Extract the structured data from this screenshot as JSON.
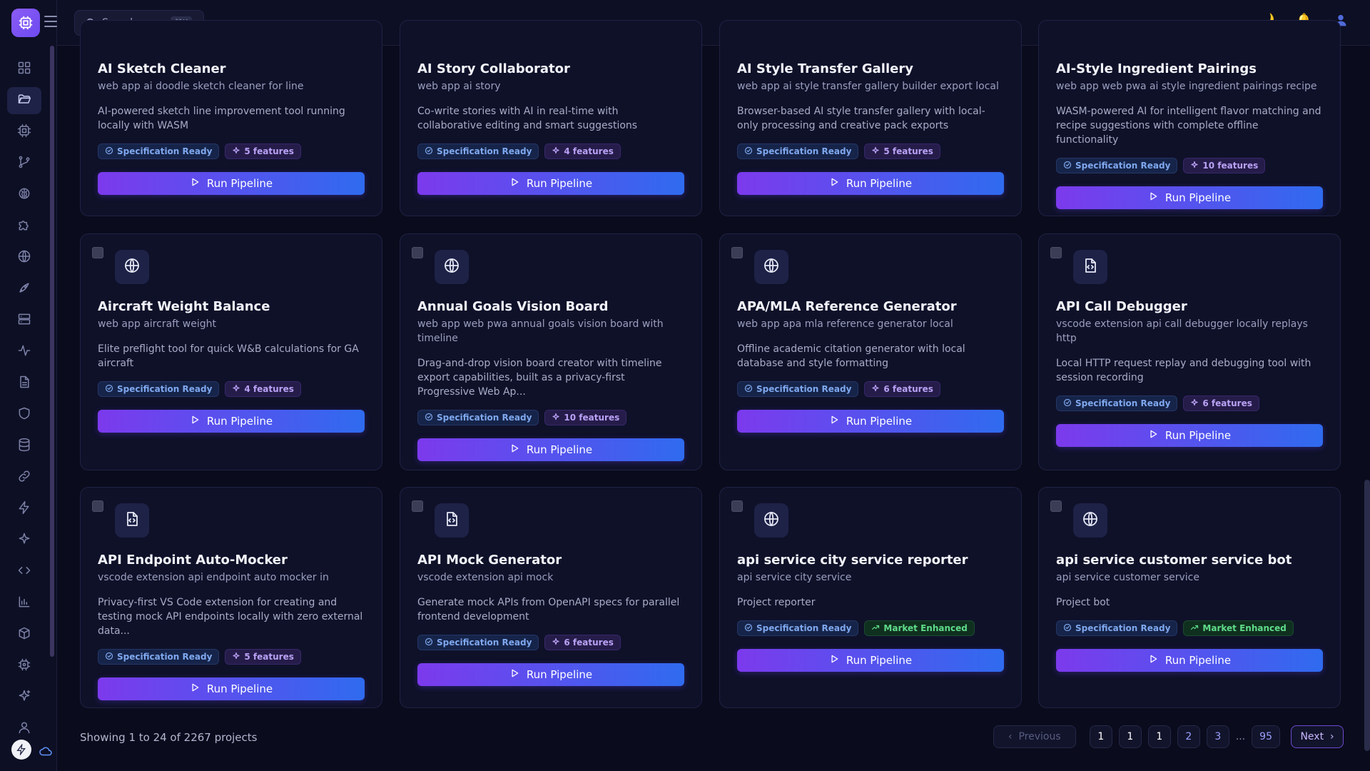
{
  "topbar": {
    "search_placeholder": "Search...",
    "search_shortcut": "⌘K",
    "theme_icon": "moon-icon",
    "notification_icon": "bell-icon",
    "user_icon": "user-icon"
  },
  "sidebar": {
    "items": [
      {
        "icon": "dashboard-icon",
        "active": false
      },
      {
        "icon": "folder-open-icon",
        "active": true
      },
      {
        "icon": "cpu-icon",
        "active": false
      },
      {
        "icon": "git-branch-icon",
        "active": false
      },
      {
        "icon": "brain-icon",
        "active": false
      },
      {
        "icon": "puzzle-icon",
        "active": false
      },
      {
        "icon": "globe-icon",
        "active": false
      },
      {
        "icon": "rocket-icon",
        "active": false
      },
      {
        "icon": "server-icon",
        "active": false
      },
      {
        "icon": "activity-icon",
        "active": false
      },
      {
        "icon": "file-text-icon",
        "active": false
      },
      {
        "icon": "shield-icon",
        "active": false
      },
      {
        "icon": "database-icon",
        "active": false
      },
      {
        "icon": "link-icon",
        "active": false
      },
      {
        "icon": "zap-icon",
        "active": false
      },
      {
        "icon": "sparkles-icon",
        "active": false
      },
      {
        "icon": "code-icon",
        "active": false
      },
      {
        "icon": "bar-chart-icon",
        "active": false
      },
      {
        "icon": "package-icon",
        "active": false
      },
      {
        "icon": "chip-icon",
        "active": false
      },
      {
        "icon": "star-icon",
        "active": false
      },
      {
        "icon": "user-icon",
        "active": false
      }
    ]
  },
  "cards": [
    {
      "title": "AI Sketch Cleaner",
      "subtitle": "web app ai doodle sketch cleaner for line",
      "description": "AI-powered sketch line improvement tool running locally with WASM",
      "badges": [
        {
          "kind": "spec",
          "label": "Specification Ready"
        },
        {
          "kind": "feat",
          "label": "5 features"
        }
      ],
      "button": "Run Pipeline"
    },
    {
      "title": "AI Story Collaborator",
      "subtitle": "web app ai story",
      "description": "Co-write stories with AI in real-time with collaborative editing and smart suggestions",
      "badges": [
        {
          "kind": "spec",
          "label": "Specification Ready"
        },
        {
          "kind": "feat",
          "label": "4 features"
        }
      ],
      "button": "Run Pipeline"
    },
    {
      "title": "AI Style Transfer Gallery",
      "subtitle": "web app ai style transfer gallery builder export local",
      "description": "Browser-based AI style transfer gallery with local-only processing and creative pack exports",
      "badges": [
        {
          "kind": "spec",
          "label": "Specification Ready"
        },
        {
          "kind": "feat",
          "label": "5 features"
        }
      ],
      "button": "Run Pipeline"
    },
    {
      "title": "AI-Style Ingredient Pairings",
      "subtitle": "web app web pwa ai style ingredient pairings recipe",
      "description": "WASM-powered AI for intelligent flavor matching and recipe suggestions with complete offline functionality",
      "badges": [
        {
          "kind": "spec",
          "label": "Specification Ready"
        },
        {
          "kind": "feat",
          "label": "10 features"
        }
      ],
      "button": "Run Pipeline"
    },
    {
      "icon": "globe-icon",
      "title": "Aircraft Weight Balance",
      "subtitle": "web app aircraft weight",
      "description": "Elite preflight tool for quick W&B calculations for GA aircraft",
      "badges": [
        {
          "kind": "spec",
          "label": "Specification Ready"
        },
        {
          "kind": "feat",
          "label": "4 features"
        }
      ],
      "button": "Run Pipeline"
    },
    {
      "icon": "globe-icon",
      "title": "Annual Goals Vision Board",
      "subtitle": "web app web pwa annual goals vision board with timeline",
      "description": "Drag-and-drop vision board creator with timeline export capabilities, built as a privacy-first Progressive Web Ap...",
      "badges": [
        {
          "kind": "spec",
          "label": "Specification Ready"
        },
        {
          "kind": "feat",
          "label": "10 features"
        }
      ],
      "button": "Run Pipeline"
    },
    {
      "icon": "globe-icon",
      "title": "APA/MLA Reference Generator",
      "subtitle": "web app apa mla reference generator local",
      "description": "Offline academic citation generator with local database and style formatting",
      "badges": [
        {
          "kind": "spec",
          "label": "Specification Ready"
        },
        {
          "kind": "feat",
          "label": "6 features"
        }
      ],
      "button": "Run Pipeline"
    },
    {
      "icon": "file-code-icon",
      "title": "API Call Debugger",
      "subtitle": "vscode extension api call debugger locally replays http",
      "description": "Local HTTP request replay and debugging tool with session recording",
      "badges": [
        {
          "kind": "spec",
          "label": "Specification Ready"
        },
        {
          "kind": "feat",
          "label": "6 features"
        }
      ],
      "button": "Run Pipeline"
    },
    {
      "icon": "file-code-icon",
      "title": "API Endpoint Auto-Mocker",
      "subtitle": "vscode extension api endpoint auto mocker in",
      "description": "Privacy-first VS Code extension for creating and testing mock API endpoints locally with zero external data...",
      "badges": [
        {
          "kind": "spec",
          "label": "Specification Ready"
        },
        {
          "kind": "feat",
          "label": "5 features"
        }
      ],
      "button": "Run Pipeline"
    },
    {
      "icon": "file-code-icon",
      "title": "API Mock Generator",
      "subtitle": "vscode extension api mock",
      "description": "Generate mock APIs from OpenAPI specs for parallel frontend development",
      "badges": [
        {
          "kind": "spec",
          "label": "Specification Ready"
        },
        {
          "kind": "feat",
          "label": "6 features"
        }
      ],
      "button": "Run Pipeline"
    },
    {
      "icon": "globe-icon",
      "title": "api service city service reporter",
      "subtitle": "api service city service",
      "description": "Project reporter",
      "badges": [
        {
          "kind": "spec",
          "label": "Specification Ready"
        },
        {
          "kind": "market",
          "label": "Market Enhanced"
        }
      ],
      "button": "Run Pipeline"
    },
    {
      "icon": "globe-icon",
      "title": "api service customer service bot",
      "subtitle": "api service customer service",
      "description": "Project bot",
      "badges": [
        {
          "kind": "spec",
          "label": "Specification Ready"
        },
        {
          "kind": "market",
          "label": "Market Enhanced"
        }
      ],
      "button": "Run Pipeline"
    }
  ],
  "footer": {
    "showing": "Showing 1 to 24 of 2267 projects",
    "previous": "Previous",
    "next": "Next",
    "pages": [
      "1",
      "1",
      "1",
      "2",
      "3"
    ],
    "ellipsis": "...",
    "last_page": "95"
  }
}
